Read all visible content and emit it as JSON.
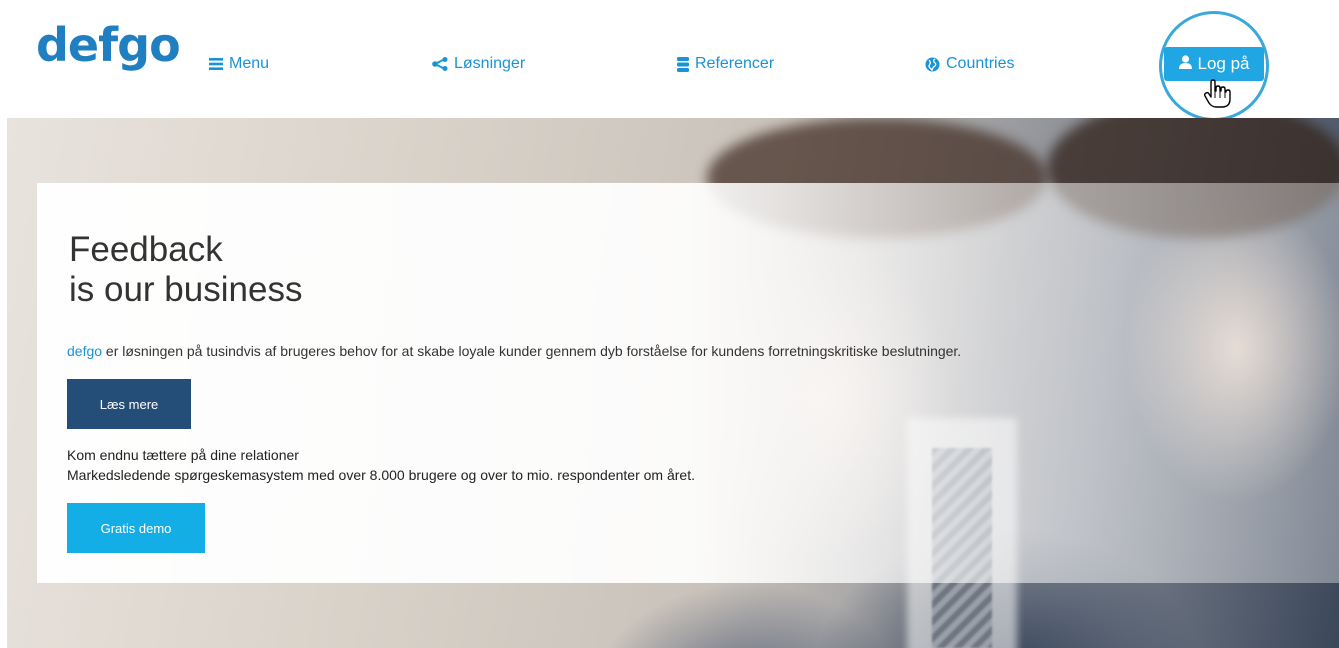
{
  "header": {
    "logo": "defgo",
    "nav": {
      "menu": "Menu",
      "solutions": "Løsninger",
      "references": "Referencer",
      "countries": "Countries"
    },
    "login": "Log på"
  },
  "hero": {
    "title_line1": "Feedback",
    "title_line2": "is our business",
    "desc_brand": "defgo",
    "desc_rest": " er løsningen på tusindvis af brugeres behov for at skabe loyale kunder gennem dyb forståelse for kundens forretningskritiske beslutninger.",
    "read_more": "Læs mere",
    "tagline1": "Kom endnu tættere på dine relationer",
    "tagline2": "Markedsledende spørgeskemasystem med over 8.000 brugere og over to mio. respondenter om året.",
    "demo": "Gratis demo"
  },
  "colors": {
    "brand_blue": "#1f7fc0",
    "nav_blue": "#1a93d6",
    "login_blue": "#1fa6e3",
    "read_more_bg": "#244e78",
    "demo_bg": "#13aee6"
  },
  "icons": {
    "menu": "hamburger-icon",
    "solutions": "share-icon",
    "references": "database-icon",
    "countries": "globe-icon",
    "login": "user-icon",
    "cursor": "hand-pointer-icon"
  }
}
